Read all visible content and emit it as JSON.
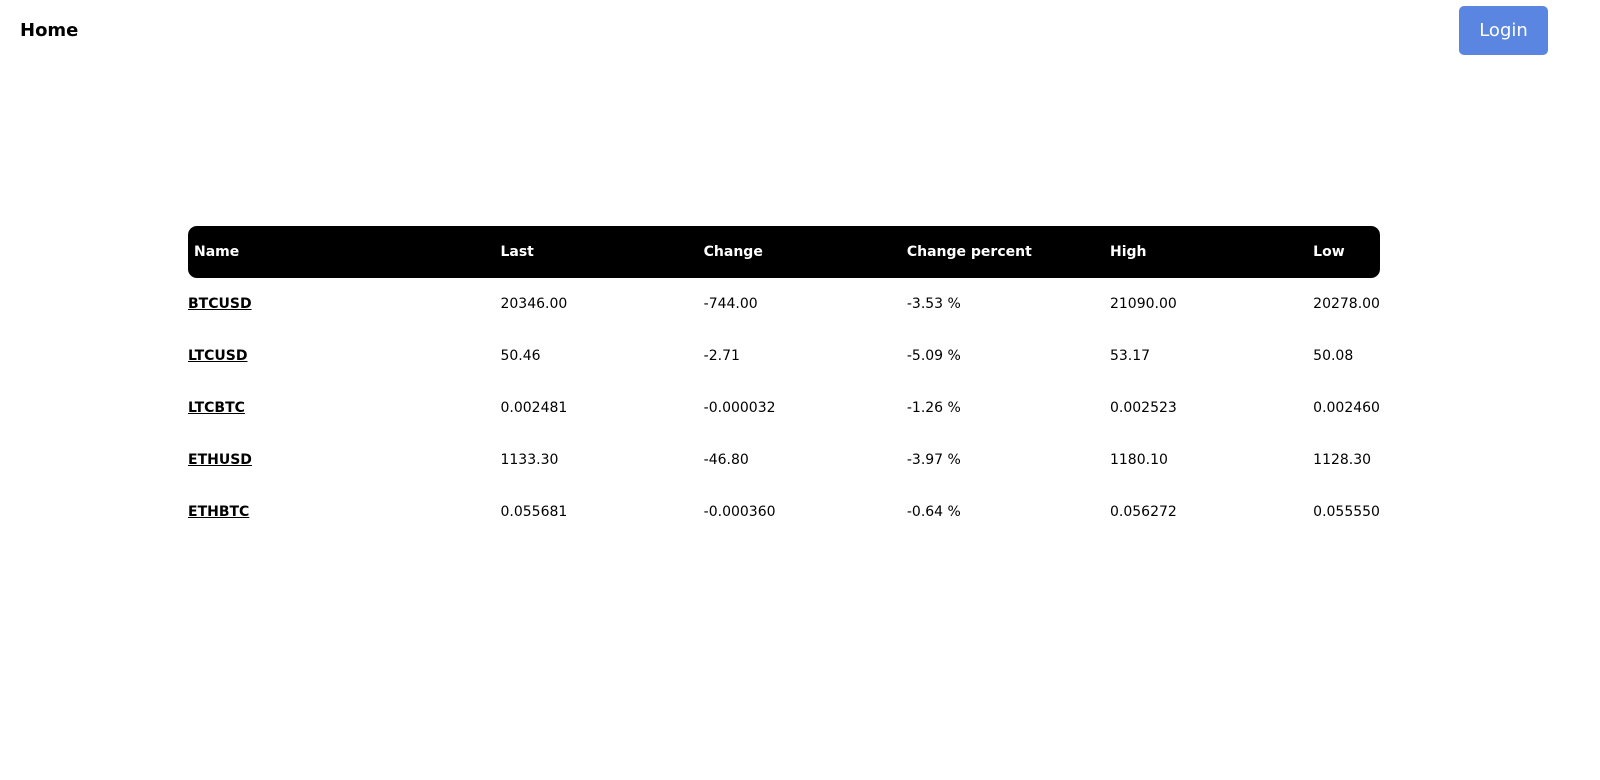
{
  "nav": {
    "home_label": "Home",
    "login_label": "Login",
    "login_color": "#5a85e0"
  },
  "table": {
    "headers": [
      "Name",
      "Last",
      "Change",
      "Change percent",
      "High",
      "Low"
    ],
    "rows": [
      {
        "name": "BTCUSD",
        "last": "20346.00",
        "change": "-744.00",
        "change_percent": "-3.53 %",
        "high": "21090.00",
        "low": "20278.00"
      },
      {
        "name": "LTCUSD",
        "last": "50.46",
        "change": "-2.71",
        "change_percent": "-5.09 %",
        "high": "53.17",
        "low": "50.08"
      },
      {
        "name": "LTCBTC",
        "last": "0.002481",
        "change": "-0.000032",
        "change_percent": "-1.26 %",
        "high": "0.002523",
        "low": "0.002460"
      },
      {
        "name": "ETHUSD",
        "last": "1133.30",
        "change": "-46.80",
        "change_percent": "-3.97 %",
        "high": "1180.10",
        "low": "1128.30"
      },
      {
        "name": "ETHBTC",
        "last": "0.055681",
        "change": "-0.000360",
        "change_percent": "-0.64 %",
        "high": "0.056272",
        "low": "0.055550"
      }
    ]
  }
}
